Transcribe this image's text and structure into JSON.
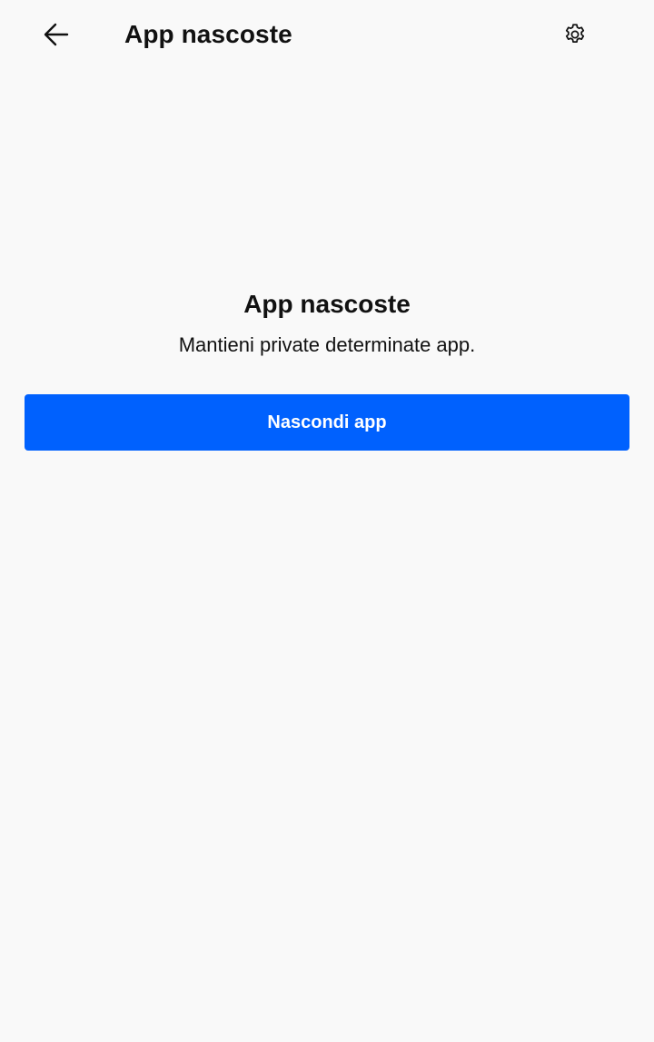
{
  "header": {
    "title": "App nascoste",
    "back_icon": "arrow-left-icon",
    "settings_icon": "gear-icon"
  },
  "empty_state": {
    "title": "App nascoste",
    "subtitle": "Mantieni private determinate app."
  },
  "actions": {
    "hide_apps_label": "Nascondi app"
  },
  "colors": {
    "background": "#f9f9f9",
    "primary": "#0061fe",
    "text": "#111111",
    "on_primary": "#ffffff"
  }
}
